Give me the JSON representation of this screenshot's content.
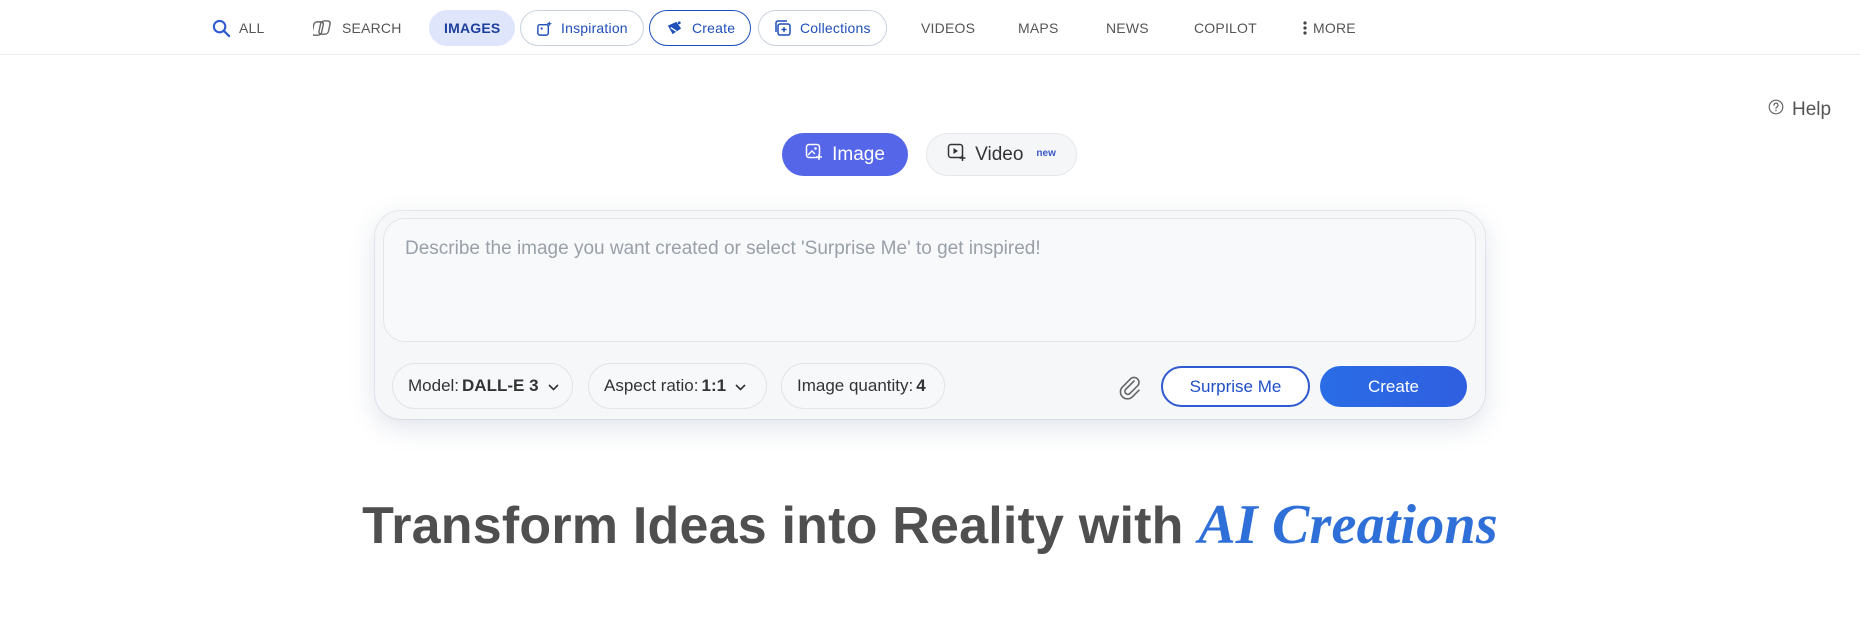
{
  "nav": {
    "all": "ALL",
    "search": "SEARCH",
    "images": "IMAGES",
    "inspiration": "Inspiration",
    "create": "Create",
    "collections": "Collections",
    "videos": "VIDEOS",
    "maps": "MAPS",
    "news": "NEWS",
    "copilot": "COPILOT",
    "more": "MORE"
  },
  "help": {
    "label": "Help"
  },
  "mode": {
    "image": "Image",
    "video": "Video",
    "video_badge": "new"
  },
  "prompt": {
    "placeholder": "Describe the image you want created or select 'Surprise Me' to get inspired!",
    "value": ""
  },
  "options": {
    "model_label": "Model:",
    "model_value": "DALL-E 3",
    "aspect_label": "Aspect ratio:",
    "aspect_value": "1:1",
    "quantity_label": "Image quantity:",
    "quantity_value": "4"
  },
  "actions": {
    "surprise": "Surprise Me",
    "create": "Create"
  },
  "headline": {
    "main": "Transform Ideas into Reality with ",
    "accent": "AI Creations"
  },
  "colors": {
    "accent_blue": "#2f6fd8",
    "image_mode": "#5567e8",
    "create_button": "#2a6ce6",
    "active_tab_bg": "#dfe6fb"
  }
}
